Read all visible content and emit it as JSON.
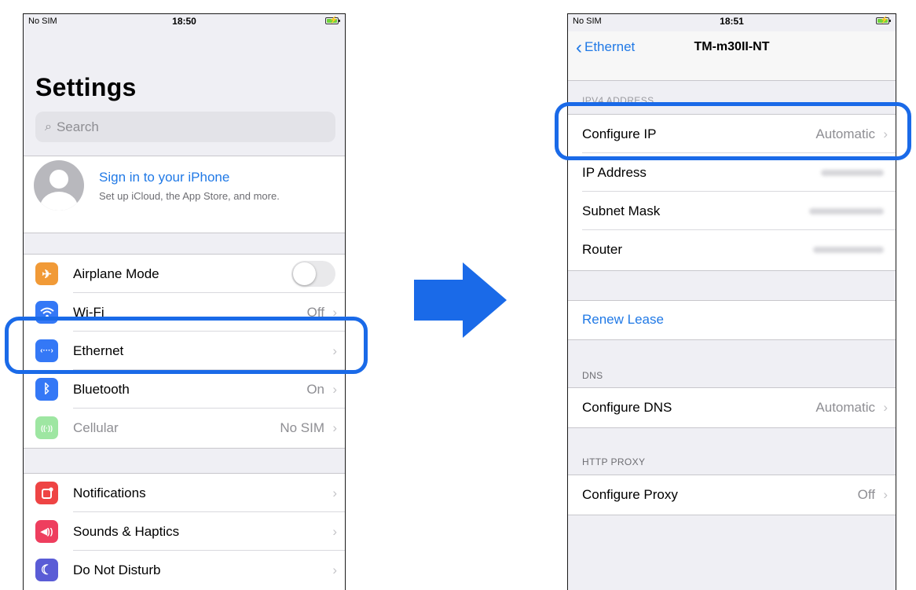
{
  "left": {
    "status": {
      "carrier": "No SIM",
      "time": "18:50"
    },
    "title": "Settings",
    "search_placeholder": "Search",
    "profile": {
      "title": "Sign in to your iPhone",
      "subtitle": "Set up iCloud, the App Store, and more."
    },
    "rows1": [
      {
        "label": "Airplane Mode",
        "value": "",
        "icon": "airplane-icon",
        "color": "#f19a37",
        "glyph": "✈"
      },
      {
        "label": "Wi-Fi",
        "value": "Off",
        "icon": "wifi-icon",
        "color": "#3478f6",
        "glyph": "◠"
      },
      {
        "label": "Ethernet",
        "value": "",
        "icon": "ethernet-icon",
        "color": "#3478f6",
        "glyph": "‹··›"
      },
      {
        "label": "Bluetooth",
        "value": "On",
        "icon": "bluetooth-icon",
        "color": "#3478f6",
        "glyph": "ᛒ"
      },
      {
        "label": "Cellular",
        "value": "No SIM",
        "icon": "cellular-icon",
        "color": "#9ee6a2",
        "glyph": "((·))"
      }
    ],
    "rows2": [
      {
        "label": "Notifications",
        "icon": "notifications-icon",
        "color": "#ee4444",
        "glyph": "▢"
      },
      {
        "label": "Sounds & Haptics",
        "icon": "sound-icon",
        "color": "#ee3e5e",
        "glyph": "◀)"
      },
      {
        "label": "Do Not Disturb",
        "icon": "moon-icon",
        "color": "#5a5cd6",
        "glyph": "☾"
      }
    ]
  },
  "right": {
    "status": {
      "carrier": "No SIM",
      "time": "18:51"
    },
    "nav": {
      "back": "Ethernet",
      "title": "TM-m30II-NT"
    },
    "ipv4_header": "IPV4 ADDRESS",
    "rows": [
      {
        "label": "Configure IP",
        "value": "Automatic"
      },
      {
        "label": "IP Address"
      },
      {
        "label": "Subnet Mask"
      },
      {
        "label": "Router"
      }
    ],
    "renew": "Renew Lease",
    "dns_header": "DNS",
    "dns_row": {
      "label": "Configure DNS",
      "value": "Automatic"
    },
    "proxy_header": "HTTP PROXY",
    "proxy_row": {
      "label": "Configure Proxy",
      "value": "Off"
    }
  },
  "colors": {
    "accent": "#2079e6",
    "highlight": "#1a6ae8",
    "arrow": "#1a6ae8"
  }
}
